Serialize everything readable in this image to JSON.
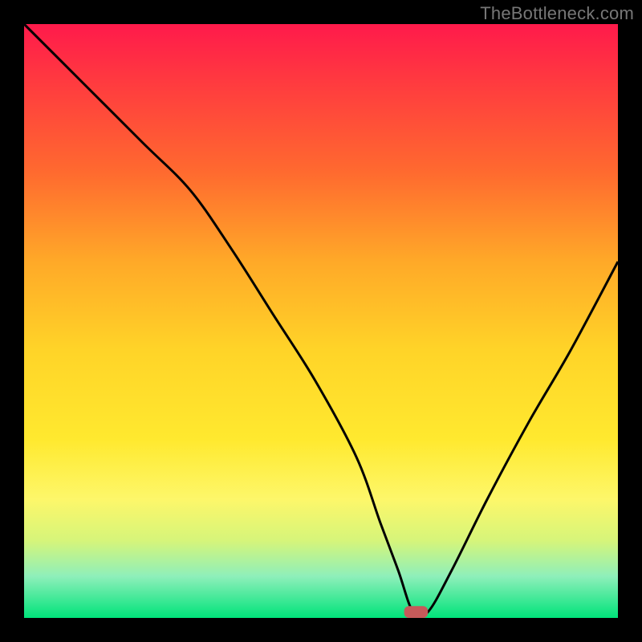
{
  "watermark": "TheBottleneck.com",
  "colors": {
    "curve": "#000000",
    "marker": "#c65a5a"
  },
  "chart_data": {
    "type": "line",
    "title": "",
    "xlabel": "",
    "ylabel": "",
    "xlim": [
      0,
      100
    ],
    "ylim": [
      0,
      100
    ],
    "x": [
      0,
      10,
      20,
      28,
      35,
      42,
      49,
      56,
      60,
      63,
      65.5,
      68,
      72,
      78,
      85,
      92,
      100
    ],
    "values": [
      100,
      90,
      80,
      72,
      62,
      51,
      40,
      27,
      16,
      8,
      1,
      1,
      8,
      20,
      33,
      45,
      60
    ],
    "marker": {
      "x": 66,
      "y": 0,
      "w": 4,
      "h": 2
    }
  }
}
